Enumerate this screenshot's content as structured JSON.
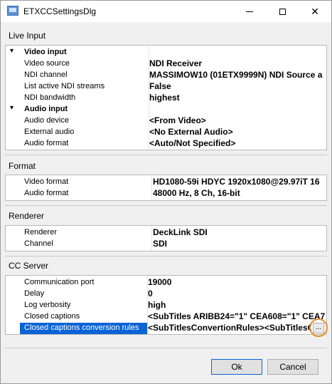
{
  "window": {
    "title": "ETXCCSettingsDlg",
    "app_icon": "dialog-app-icon",
    "controls": {
      "minimize": "minimize-icon",
      "maximize": "maximize-icon",
      "close": "close-icon",
      "close_glyph": "✕"
    }
  },
  "live_input": {
    "label": "Live Input",
    "categories": [
      {
        "label": "Video input",
        "toggle": "▾",
        "props": [
          {
            "name": "Video source",
            "value": "NDI Receiver"
          },
          {
            "name": "NDI channel",
            "value": "MASSIMOW10 (01ETX9999N) NDI Source a"
          },
          {
            "name": "List active NDI streams",
            "value": "False"
          },
          {
            "name": "NDI bandwidth",
            "value": "highest"
          }
        ]
      },
      {
        "label": "Audio input",
        "toggle": "▾",
        "props": [
          {
            "name": "Audio device",
            "value": "<From Video>"
          },
          {
            "name": "External audio",
            "value": "<No External Audio>"
          },
          {
            "name": "Audio format",
            "value": "<Auto/Not Specified>"
          }
        ]
      }
    ]
  },
  "format": {
    "label": "Format",
    "props": [
      {
        "name": "Video format",
        "value": "HD1080-59i HDYC 1920x1080@29.97iT 16"
      },
      {
        "name": "Audio format",
        "value": "48000 Hz, 8 Ch, 16-bit"
      }
    ]
  },
  "renderer": {
    "label": "Renderer",
    "props": [
      {
        "name": "Renderer",
        "value": "DeckLink SDI"
      },
      {
        "name": "Channel",
        "value": "SDI"
      }
    ]
  },
  "cc_server": {
    "label": "CC Server",
    "props": [
      {
        "name": "Communication port",
        "value": "19000"
      },
      {
        "name": "Delay",
        "value": "0"
      },
      {
        "name": "Log verbosity",
        "value": "high"
      },
      {
        "name": "Closed captions",
        "value": "<SubTitles ARIBB24=\"1\" CEA608=\"1\" CEA7"
      },
      {
        "name": "Closed captions conversion rules",
        "value": "<SubTitlesConvertionRules><SubTitlesCo"
      }
    ],
    "selected_index": 4,
    "ellipsis_label": "..."
  },
  "buttons": {
    "ok": "Ok",
    "cancel": "Cancel"
  },
  "colors": {
    "selection": "#0a64d6",
    "highlight_circle": "#e8902a"
  }
}
